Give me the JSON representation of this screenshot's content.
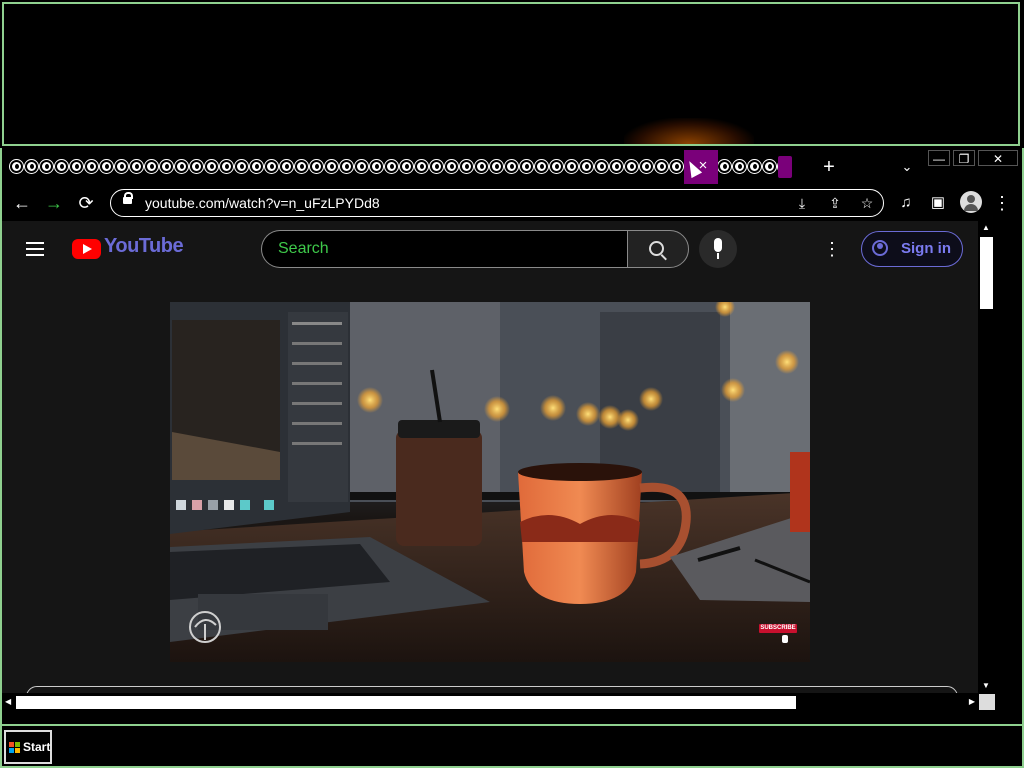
{
  "tabs": {
    "new_tab_symbol": "+",
    "close_symbol": "×",
    "search_symbol": "⌄",
    "count": 55
  },
  "window_controls": {
    "minimize": "—",
    "restore": "❐",
    "close": "✕"
  },
  "toolbar": {
    "back": "←",
    "forward": "→",
    "reload": "⟳",
    "url": "youtube.com/watch?v=n_uFzLPYDd8",
    "install": "⤓",
    "share": "⇪",
    "star": "☆",
    "media": "♫",
    "sidebar": "▣",
    "menu": "⋮"
  },
  "youtube": {
    "logo_text": "YouTube",
    "search_placeholder": "Search",
    "more": "⋮",
    "signin": "Sign in"
  },
  "video": {
    "subscribe_label": "SUBSCRIBE"
  },
  "scrollbars": {
    "up": "▲",
    "down": "▼",
    "left": "◀",
    "right": "▶"
  },
  "taskbar": {
    "start": "Start"
  },
  "colors": {
    "accent_purple": "#7a007a",
    "window_border": "#8fd08f",
    "search_text": "#3ec94a",
    "signin": "#7b7bf0",
    "youtube_red": "#ff0000",
    "forward_arrow": "#3ec94a"
  }
}
